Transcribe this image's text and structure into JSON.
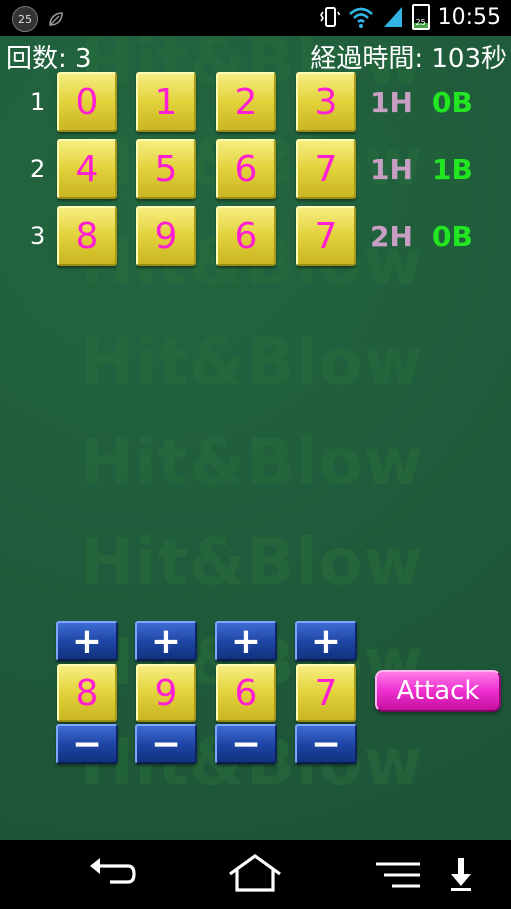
{
  "status_bar": {
    "notification_badge": "25",
    "battery_level_text": "25",
    "battery_fraction": 0.25,
    "time": "10:55",
    "icons": [
      "notification-badge-icon",
      "leaf-icon",
      "vibrate-icon",
      "wifi-icon",
      "signal-icon",
      "battery-icon"
    ]
  },
  "header": {
    "attempts_text": "回数: 3",
    "elapsed_text": "経過時間: 103秒"
  },
  "watermark_text": "Hit&Blow",
  "history": [
    {
      "num": "1",
      "digits": [
        "0",
        "1",
        "2",
        "3"
      ],
      "hit": "1H",
      "blow": "0B"
    },
    {
      "num": "2",
      "digits": [
        "4",
        "5",
        "6",
        "7"
      ],
      "hit": "1H",
      "blow": "1B"
    },
    {
      "num": "3",
      "digits": [
        "8",
        "9",
        "6",
        "7"
      ],
      "hit": "2H",
      "blow": "0B"
    }
  ],
  "input": {
    "digits": [
      "8",
      "9",
      "6",
      "7"
    ],
    "plus_label": "+",
    "minus_label": "−",
    "attack_label": "Attack"
  },
  "colors": {
    "felt": "#1f5a3a",
    "digit": "#ff1ed2",
    "hit": "#c89fc4",
    "blow": "#22e622",
    "attack": "#ee2fce"
  },
  "nav": [
    "back-icon",
    "home-icon",
    "menu-icon",
    "download-icon"
  ]
}
